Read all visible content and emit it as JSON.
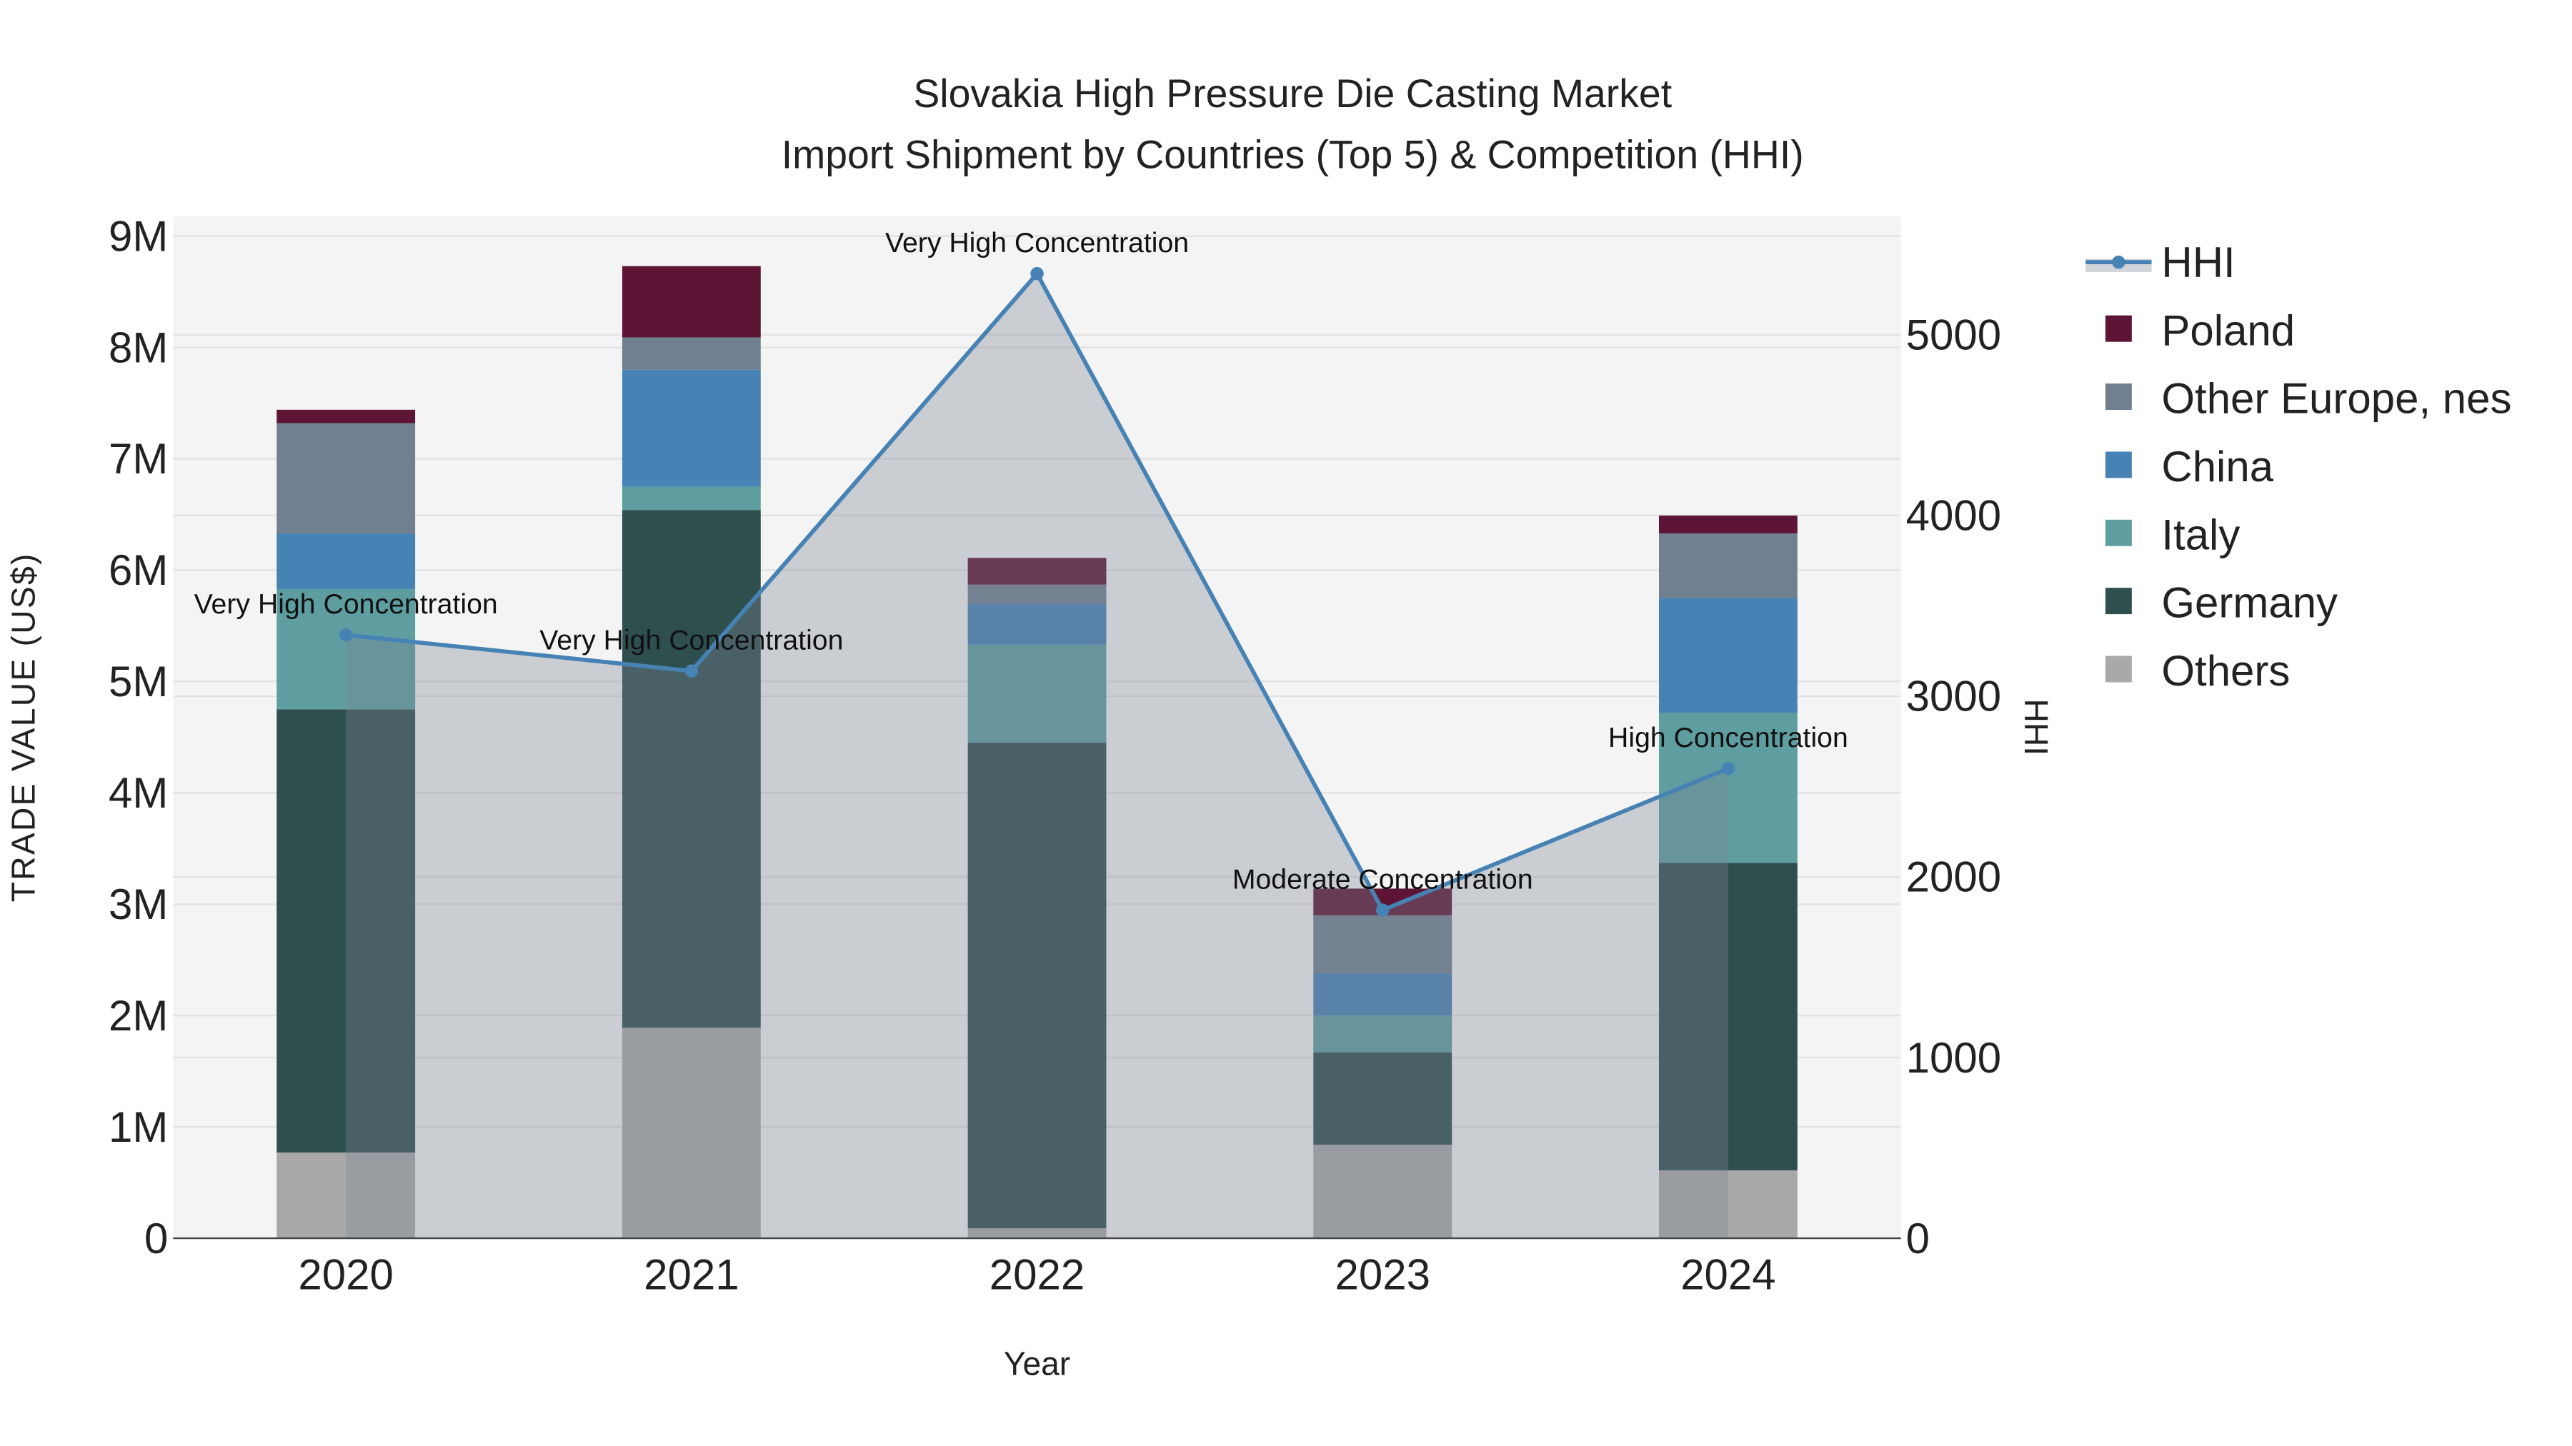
{
  "chart_data": {
    "type": "bar",
    "title": "Slovakia High Pressure Die Casting Market",
    "subtitle": "Import Shipment by Countries (Top 5) & Competition (HHI)",
    "xlabel": "Year",
    "ylabel": "TRADE VALUE (US$)",
    "y2label": "HHI",
    "categories": [
      "2020",
      "2021",
      "2022",
      "2023",
      "2024"
    ],
    "ylim": [
      0,
      9180000
    ],
    "y2lim": [
      0,
      5657
    ],
    "yticks": [
      {
        "v": 0,
        "label": "0"
      },
      {
        "v": 1000000,
        "label": "1M"
      },
      {
        "v": 2000000,
        "label": "2M"
      },
      {
        "v": 3000000,
        "label": "3M"
      },
      {
        "v": 4000000,
        "label": "4M"
      },
      {
        "v": 5000000,
        "label": "5M"
      },
      {
        "v": 6000000,
        "label": "6M"
      },
      {
        "v": 7000000,
        "label": "7M"
      },
      {
        "v": 8000000,
        "label": "8M"
      },
      {
        "v": 9000000,
        "label": "9M"
      }
    ],
    "y2ticks": [
      {
        "v": 0,
        "label": "0"
      },
      {
        "v": 1000,
        "label": "1000"
      },
      {
        "v": 2000,
        "label": "2000"
      },
      {
        "v": 3000,
        "label": "3000"
      },
      {
        "v": 4000,
        "label": "4000"
      },
      {
        "v": 5000,
        "label": "5000"
      }
    ],
    "series": [
      {
        "name": "Others",
        "color": "#a9a9a9",
        "values": [
          770000,
          1890000,
          90000,
          840000,
          610000
        ]
      },
      {
        "name": "Germany",
        "color": "#2f4f4f",
        "values": [
          3980000,
          4650000,
          4360000,
          830000,
          2760000
        ]
      },
      {
        "name": "Italy",
        "color": "#5f9ea0",
        "values": [
          1080000,
          210000,
          880000,
          330000,
          1350000
        ]
      },
      {
        "name": "China",
        "color": "#4682b4",
        "values": [
          500000,
          1050000,
          370000,
          380000,
          1030000
        ]
      },
      {
        "name": "Other Europe, nes",
        "color": "#708090",
        "values": [
          990000,
          290000,
          170000,
          520000,
          580000
        ]
      },
      {
        "name": "Poland",
        "color": "#5e1535",
        "values": [
          120000,
          640000,
          240000,
          240000,
          160000
        ]
      }
    ],
    "hhi": {
      "name": "HHI",
      "color": "#4682b4",
      "values": [
        3339,
        3139,
        5338,
        1816,
        2600
      ],
      "annotations": [
        "Very High Concentration",
        "Very High Concentration",
        "Very High Concentration",
        "Moderate Concentration",
        "High Concentration"
      ]
    },
    "legend": [
      "HHI",
      "Poland",
      "Other Europe, nes",
      "China",
      "Italy",
      "Germany",
      "Others"
    ],
    "legend_position": "right",
    "grid": true
  }
}
